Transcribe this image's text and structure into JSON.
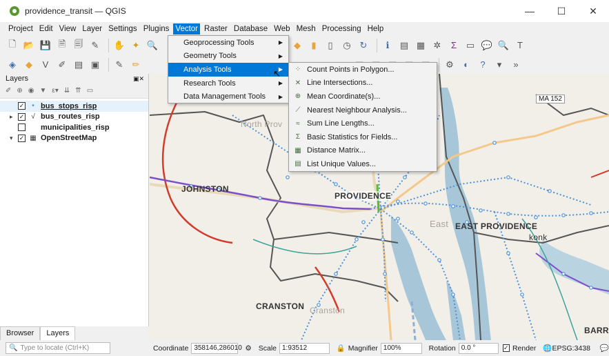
{
  "window": {
    "title": "providence_transit — QGIS",
    "minimize": "—",
    "maximize": "☐",
    "close": "✕"
  },
  "menubar": [
    "Project",
    "Edit",
    "View",
    "Layer",
    "Settings",
    "Plugins",
    "Vector",
    "Raster",
    "Database",
    "Web",
    "Mesh",
    "Processing",
    "Help"
  ],
  "active_menu": "Vector",
  "vector_menu": [
    {
      "label": "Geoprocessing Tools",
      "submenu": true
    },
    {
      "label": "Geometry Tools",
      "submenu": true
    },
    {
      "label": "Analysis Tools",
      "submenu": true,
      "highlighted": true
    },
    {
      "label": "Research Tools",
      "submenu": true
    },
    {
      "label": "Data Management Tools",
      "submenu": true
    }
  ],
  "analysis_tools": [
    {
      "label": "Count Points in Polygon...",
      "icon": "count-points-icon"
    },
    {
      "label": "Line Intersections...",
      "icon": "line-intersections-icon"
    },
    {
      "label": "Mean Coordinate(s)...",
      "icon": "mean-coordinate-icon"
    },
    {
      "label": "Nearest Neighbour Analysis...",
      "icon": "nearest-neighbour-icon"
    },
    {
      "label": "Sum Line Lengths...",
      "icon": "sum-line-lengths-icon"
    },
    {
      "label": "Basic Statistics for Fields...",
      "icon": "sigma-icon"
    },
    {
      "label": "Distance Matrix...",
      "icon": "distance-matrix-icon"
    },
    {
      "label": "List Unique Values...",
      "icon": "list-unique-icon"
    }
  ],
  "layers_panel": {
    "title": "Layers",
    "layers": [
      {
        "name": "bus_stops_risp",
        "checked": true,
        "selected": true,
        "expandable": false,
        "type_icon": "•"
      },
      {
        "name": "bus_routes_risp",
        "checked": true,
        "selected": false,
        "expandable": true,
        "type_icon": "√"
      },
      {
        "name": "municipalities_risp",
        "checked": false,
        "selected": false,
        "expandable": false,
        "type_icon": ""
      },
      {
        "name": "OpenStreetMap",
        "checked": true,
        "selected": false,
        "expandable": true,
        "type_icon": "▦"
      }
    ],
    "tabs": [
      "Browser",
      "Layers"
    ],
    "active_tab": "Layers"
  },
  "map_labels": {
    "johnston": "JOHNSTON",
    "providence": "PROVIDENCE",
    "east_providence": "EAST PROVIDENCE",
    "cranston": "CRANSTON",
    "barrington": "BARRIN",
    "north_providence": "North Prov",
    "east": "East",
    "rumford": "konk",
    "ma152": "MA 152",
    "cranston_faint": "Cranston"
  },
  "statusbar": {
    "locator_placeholder": "Type to locate (Ctrl+K)",
    "coordinate_label": "Coordinate",
    "coordinate_value": "358146,286010",
    "scale_label": "Scale",
    "scale_value": "1:93512",
    "magnifier_label": "Magnifier",
    "magnifier_value": "100%",
    "rotation_label": "Rotation",
    "rotation_value": "0.0 °",
    "render_label": "Render",
    "render_checked": true,
    "crs": "EPSG:3438"
  },
  "colors": {
    "accent": "#0078d7",
    "route_blue": "#4a90d9",
    "route_red": "#d33a2c",
    "route_purple": "#7b4fc9",
    "water": "#a7c7d9",
    "boundary": "#555555"
  }
}
